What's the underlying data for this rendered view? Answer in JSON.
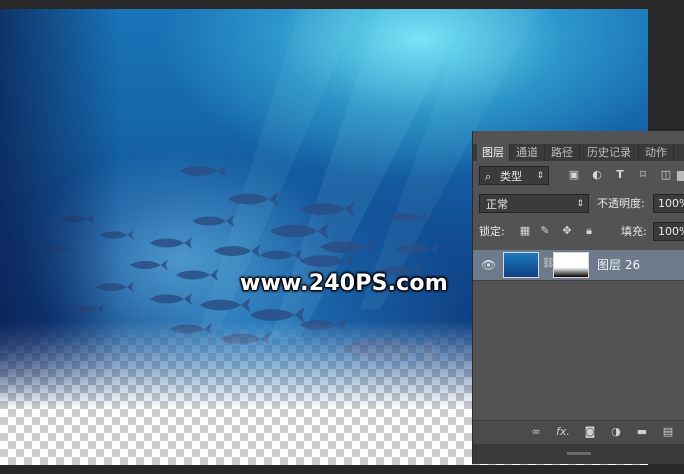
{
  "watermark": "www.240PS.com",
  "panel": {
    "tabs": [
      "图层",
      "通道",
      "路径",
      "历史记录",
      "动作"
    ],
    "filter": {
      "label": "类型",
      "icons": [
        "image-filter-icon",
        "adjustment-filter-icon",
        "type-filter-icon",
        "shape-filter-icon",
        "smart-object-filter-icon"
      ]
    },
    "blend_mode": "正常",
    "opacity_label": "不透明度:",
    "opacity_value": "100%",
    "lock_label": "锁定:",
    "fill_label": "填充:",
    "fill_value": "100%",
    "layer": {
      "name": "图层 26"
    },
    "footer_icons": [
      "link-icon",
      "fx-icon",
      "mask-icon",
      "adjustment-icon",
      "folder-icon",
      "new-layer-icon"
    ],
    "footer_fx": "fx."
  }
}
